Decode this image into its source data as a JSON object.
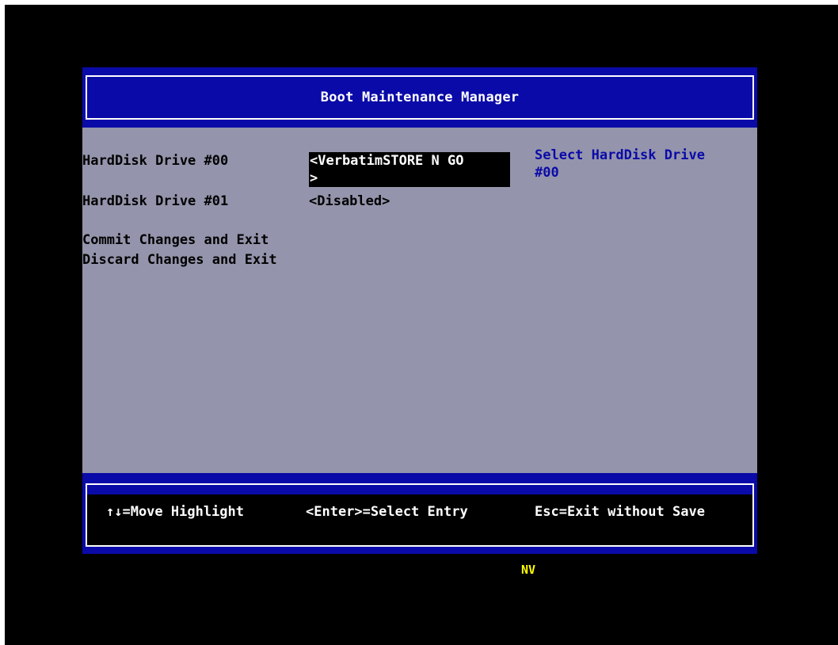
{
  "header": {
    "title": "Boot Maintenance Manager"
  },
  "menu": {
    "items": [
      {
        "label": "HardDisk Drive #00",
        "value_line1": "<VerbatimSTORE N GO",
        "value_line2": ">",
        "selected": true
      },
      {
        "label": "HardDisk Drive #01",
        "value": "<Disabled>",
        "selected": false
      }
    ],
    "actions": [
      {
        "label": "Commit Changes and Exit"
      },
      {
        "label": "Discard Changes and Exit"
      }
    ]
  },
  "help": {
    "text": "Select HardDisk Drive #00"
  },
  "footer": {
    "move": "↑↓=Move Highlight",
    "select": "<Enter>=Select Entry",
    "exit": "Esc=Exit without Save"
  },
  "status": {
    "tag": "NV"
  },
  "colors": {
    "background": "#000000",
    "bar": "#0a0aa8",
    "panel": "#9494ac",
    "help_text": "#0a0aa8",
    "status_tag": "#ffff00"
  }
}
